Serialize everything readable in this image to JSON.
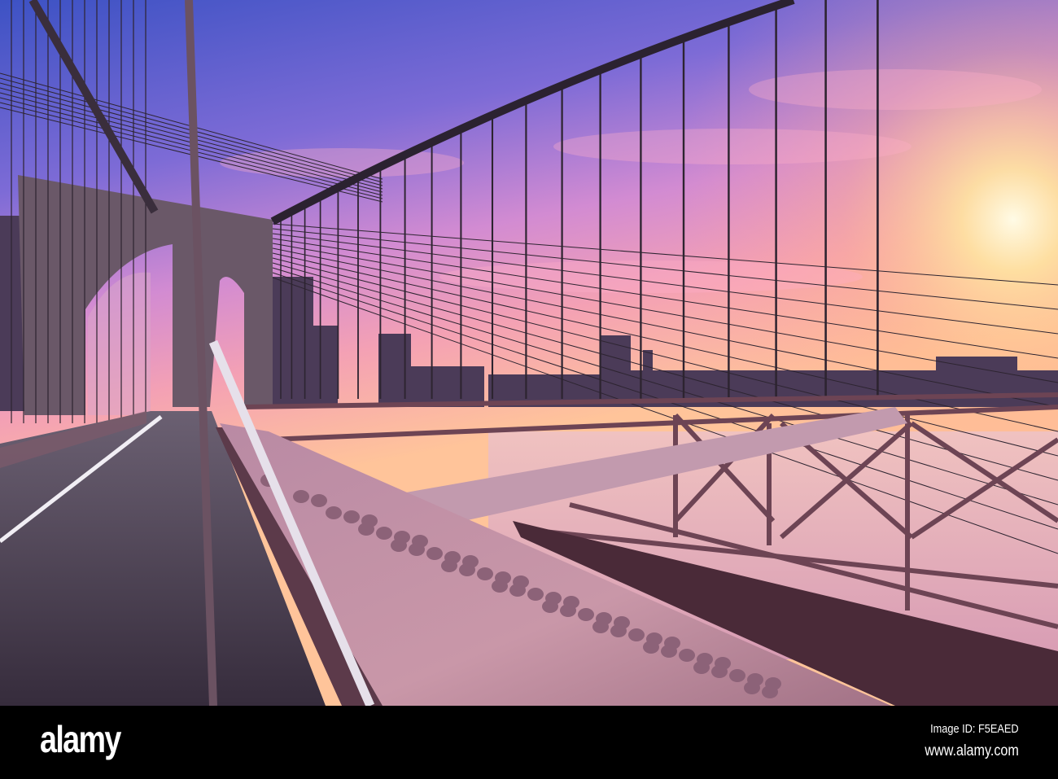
{
  "photo": {
    "subject": "bridge-at-sunset",
    "colors": {
      "sky_top": "#4256c6",
      "sky_mid": "#c486d6",
      "sky_horizon": "#ffc996",
      "sun": "#fff6d8",
      "stone": "#6a5868",
      "steel": "#c28c9e",
      "deck": "#4a4052",
      "water": "#e9b9c2",
      "skyline": "#4b3b58"
    }
  },
  "watermark": {
    "logo": "alamy",
    "image_id": "Image ID: F5EAED",
    "url": "www.alamy.com"
  }
}
